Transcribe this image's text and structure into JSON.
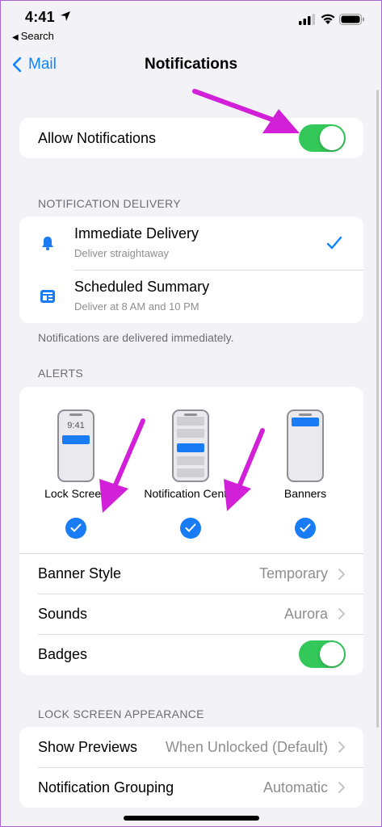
{
  "status": {
    "time": "4:41",
    "back_app": "Search"
  },
  "nav": {
    "back_label": "Mail",
    "title": "Notifications"
  },
  "allow": {
    "label": "Allow Notifications",
    "enabled": true
  },
  "delivery": {
    "section_label": "NOTIFICATION DELIVERY",
    "items": [
      {
        "title": "Immediate Delivery",
        "subtitle": "Deliver straightaway",
        "selected": true,
        "icon": "bell-icon"
      },
      {
        "title": "Scheduled Summary",
        "subtitle": "Deliver at 8 AM and 10 PM",
        "selected": false,
        "icon": "summary-icon"
      }
    ],
    "footnote": "Notifications are delivered immediately."
  },
  "alerts": {
    "section_label": "ALERTS",
    "lock_time": "9:41",
    "styles": [
      {
        "label": "Lock Screen",
        "checked": true
      },
      {
        "label": "Notification Centre",
        "checked": true
      },
      {
        "label": "Banners",
        "checked": true
      }
    ],
    "rows": {
      "banner_style": {
        "label": "Banner Style",
        "value": "Temporary"
      },
      "sounds": {
        "label": "Sounds",
        "value": "Aurora"
      },
      "badges": {
        "label": "Badges",
        "enabled": true
      }
    }
  },
  "lock_screen": {
    "section_label": "LOCK SCREEN APPEARANCE",
    "rows": {
      "show_previews": {
        "label": "Show Previews",
        "value": "When Unlocked (Default)"
      },
      "grouping": {
        "label": "Notification Grouping",
        "value": "Automatic"
      }
    }
  },
  "colors": {
    "accent": "#0a84ff",
    "toggle_on": "#34c759",
    "annotation_arrow": "#d21fd8"
  }
}
